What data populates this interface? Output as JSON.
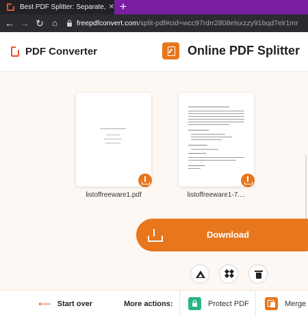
{
  "browser": {
    "tab_title": "Best PDF Splitter: Separate, Extra",
    "tab_close": "✕",
    "new_tab": "+",
    "url_host": "freepdfconvert.com",
    "url_path": "/split-pdf#cid=wcc97rdrr2808elsxzzy91bqd7elr1mr"
  },
  "header": {
    "logo_text": "PDF Converter",
    "tool_title": "Online PDF Splitter"
  },
  "files": [
    {
      "name": "listoffreeware1.pdf"
    },
    {
      "name": "listoffreeware1-7...."
    }
  ],
  "actions": {
    "download_label": "Download",
    "cloud_icons": [
      "google-drive-icon",
      "dropbox-icon",
      "trash-icon"
    ]
  },
  "footer": {
    "start_over": "Start over",
    "more_actions": "More actions:",
    "protect": "Protect PDF",
    "merge": "Merge P"
  },
  "colors": {
    "accent": "#e8761c",
    "logo_red": "#e8502a",
    "protect_green": "#2bb38a",
    "tab_bar": "#7b1fa2"
  }
}
